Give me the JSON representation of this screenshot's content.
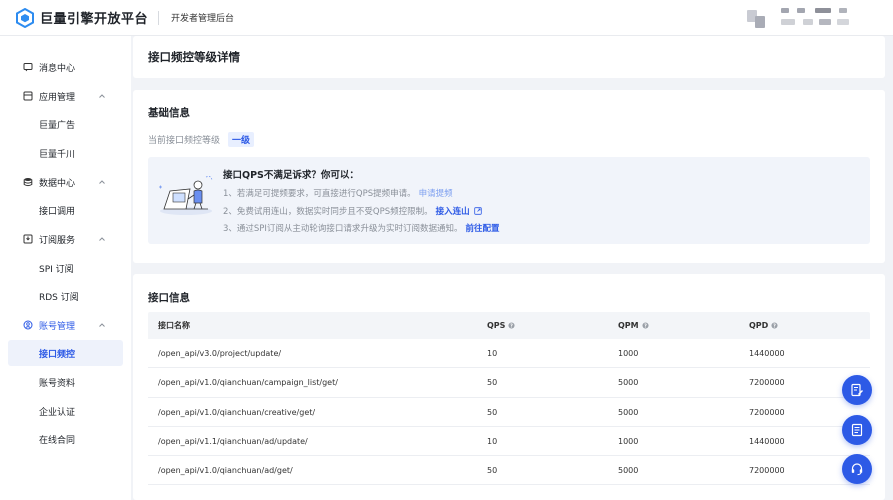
{
  "header": {
    "logo_text": "巨量引擎开放平台",
    "console_title": "开发者管理后台"
  },
  "sidebar": {
    "items": [
      {
        "label": "消息中心",
        "icon": "message-icon"
      },
      {
        "label": "应用管理",
        "icon": "app-icon"
      },
      {
        "label": "巨量广告"
      },
      {
        "label": "巨量千川"
      },
      {
        "label": "数据中心",
        "icon": "database-icon"
      },
      {
        "label": "接口调用"
      },
      {
        "label": "订阅服务",
        "icon": "subscribe-icon"
      },
      {
        "label": "SPI 订阅"
      },
      {
        "label": "RDS 订阅"
      },
      {
        "label": "账号管理",
        "icon": "account-icon"
      },
      {
        "label": "接口频控"
      },
      {
        "label": "账号资料"
      },
      {
        "label": "企业认证"
      },
      {
        "label": "在线合同"
      }
    ]
  },
  "page": {
    "title": "接口频控等级详情"
  },
  "basic_info": {
    "title": "基础信息",
    "level_label": "当前接口频控等级",
    "level_value": "一级",
    "tip": {
      "title": "接口QPS不满足诉求？你可以：",
      "line1": "1、若满足可提频要求，可直接进行QPS提频申请。",
      "line1_link": "申请提频",
      "line2": "2、免费试用连山，数据实时同步且不受QPS频控限制。",
      "line2_link": "接入连山",
      "line3": "3、通过SPI订阅从主动轮询接口请求升级为实时订阅数据通知。",
      "line3_link": "前往配置"
    }
  },
  "interface_info": {
    "title": "接口信息",
    "columns": [
      "接口名称",
      "QPS",
      "QPM",
      "QPD"
    ],
    "rows": [
      [
        "/open_api/v3.0/project/update/",
        "10",
        "1000",
        "1440000"
      ],
      [
        "/open_api/v1.0/qianchuan/campaign_list/get/",
        "50",
        "5000",
        "7200000"
      ],
      [
        "/open_api/v1.0/qianchuan/creative/get/",
        "50",
        "5000",
        "7200000"
      ],
      [
        "/open_api/v1.1/qianchuan/ad/update/",
        "10",
        "1000",
        "1440000"
      ],
      [
        "/open_api/v1.0/qianchuan/ad/get/",
        "50",
        "5000",
        "7200000"
      ]
    ]
  },
  "colors": {
    "accent": "#2d5ae6",
    "background": "#f1f3f7"
  }
}
